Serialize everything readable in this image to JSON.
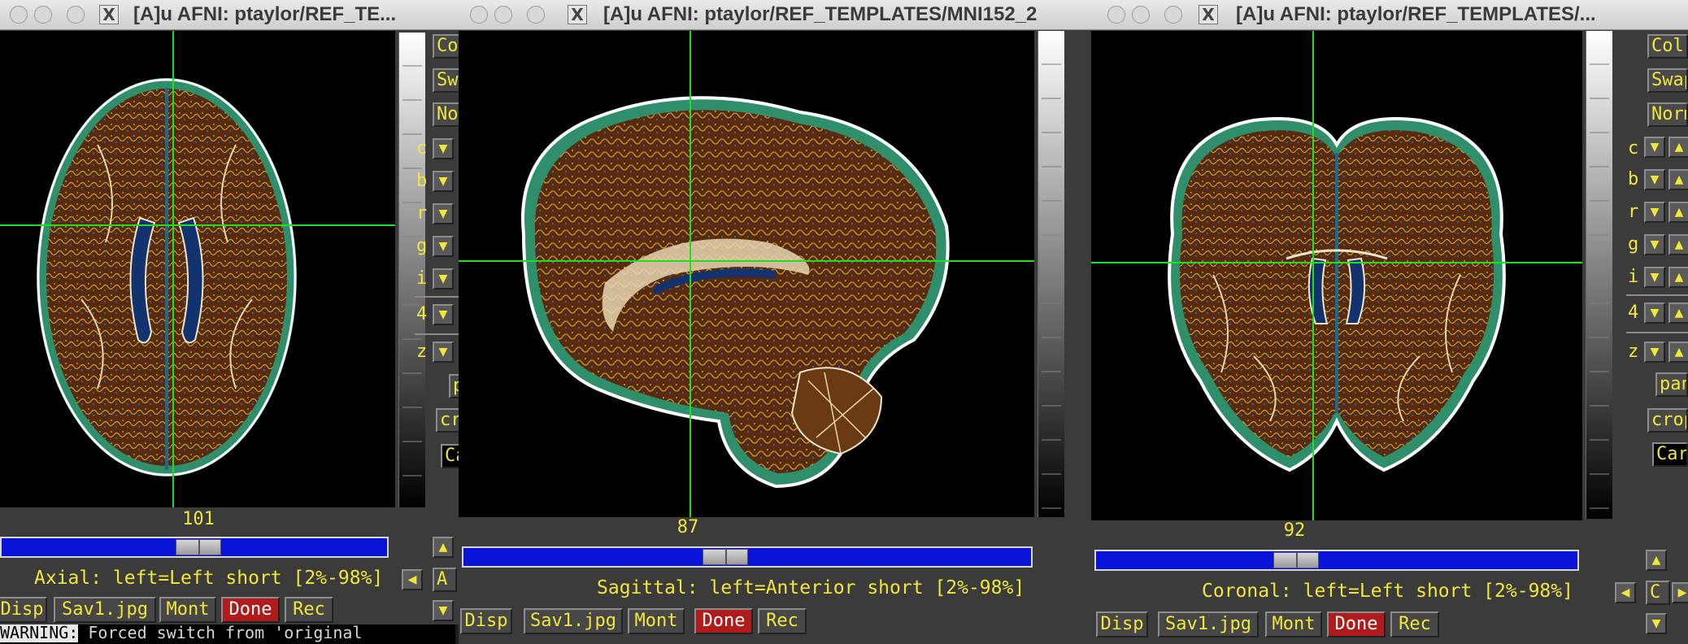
{
  "terminal": {
    "warning_label": "WARNING:",
    "message": " Forced switch from 'original"
  },
  "colors": {
    "accent": "#f1e63a",
    "crosshair": "#1ee01e",
    "slider": "#0a14d8",
    "done": "#b01c1c"
  },
  "windows": [
    {
      "title": "[A]u AFNI: ptaylor/REF_TE...",
      "slice_number": "101",
      "slice_fraction": 0.5,
      "view_label": "Axial: left=Left short [2%-98%]",
      "buttons": {
        "disp": "Disp",
        "save": "Sav1.jpg",
        "mont": "Mont",
        "done": "Done",
        "rec": "Rec"
      },
      "side": {
        "colr": "Colr",
        "swap": "Swap",
        "norm": "Norm",
        "pan": "pan",
        "crop": "crop",
        "car": "Car"
      },
      "side_letters": [
        "c",
        "b",
        "r",
        "g",
        "i",
        "4",
        "z"
      ],
      "bottom_side": "A"
    },
    {
      "title": "[A]u AFNI: ptaylor/REF_TEMPLATES/MNI152_2",
      "slice_number": "87",
      "slice_fraction": 0.48,
      "view_label": "Sagittal: left=Anterior short [2%-98%]",
      "buttons": {
        "disp": "Disp",
        "save": "Sav1.jpg",
        "mont": "Mont",
        "done": "Done",
        "rec": "Rec"
      }
    },
    {
      "title": "[A]u AFNI: ptaylor/REF_TEMPLATES/...",
      "slice_number": "92",
      "slice_fraction": 0.42,
      "view_label": "Coronal: left=Left short [2%-98%]",
      "buttons": {
        "disp": "Disp",
        "save": "Sav1.jpg",
        "mont": "Mont",
        "done": "Done",
        "rec": "Rec"
      },
      "side": {
        "colr": "Colr",
        "swap": "Swap",
        "norm": "Norm",
        "pan": "pan",
        "crop": "crop",
        "car": "Car"
      },
      "side_letters": [
        "c",
        "b",
        "r",
        "g",
        "i",
        "4",
        "z"
      ],
      "bottom_side": "C"
    }
  ]
}
